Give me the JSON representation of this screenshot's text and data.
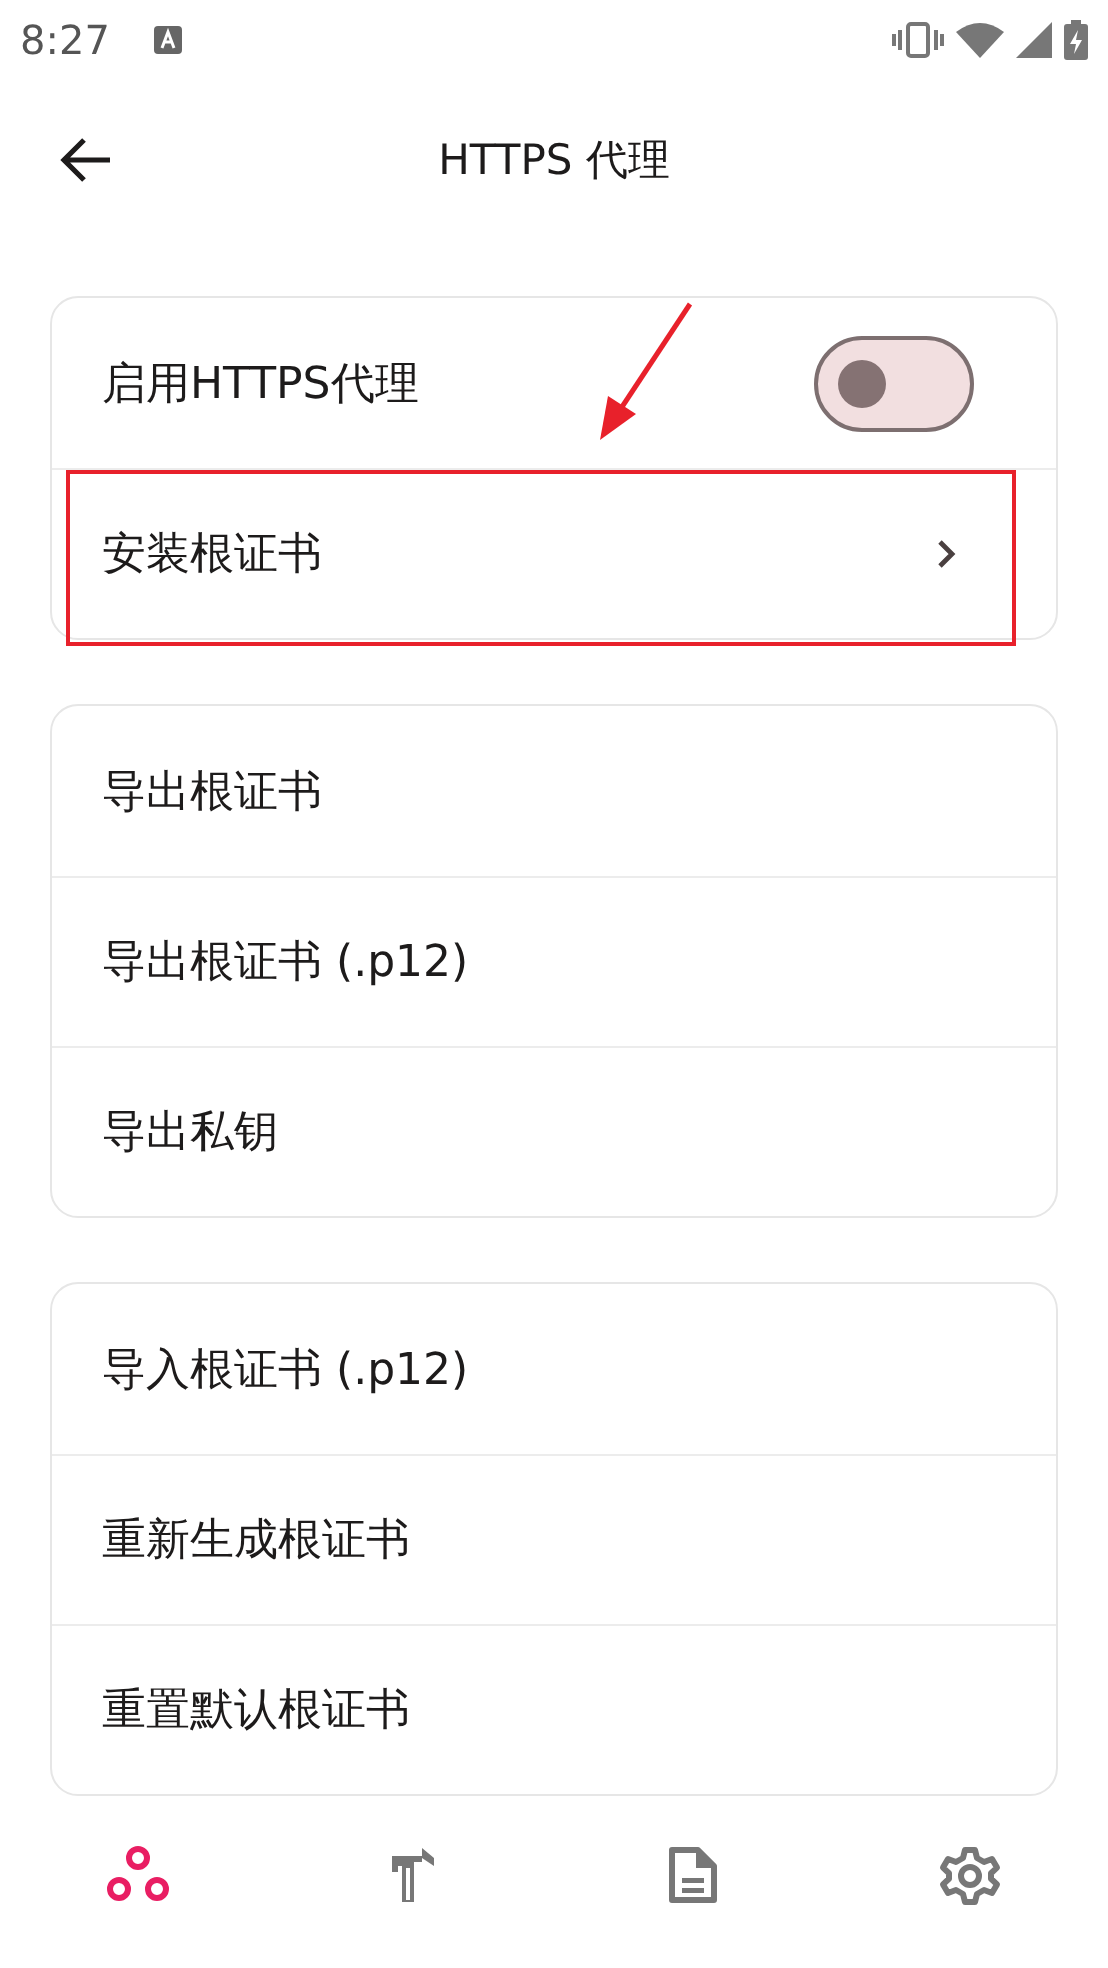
{
  "status_bar": {
    "time": "8:27"
  },
  "app_bar": {
    "title": "HTTPS 代理"
  },
  "groups": [
    {
      "items": [
        {
          "kind": "switch",
          "label": "启用HTTPS代理",
          "on": false,
          "highlighted": false
        },
        {
          "kind": "link",
          "label": "安装根证书",
          "highlighted": true
        }
      ]
    },
    {
      "items": [
        {
          "kind": "plain",
          "label": "导出根证书",
          "highlighted": false
        },
        {
          "kind": "plain",
          "label": "导出根证书 (.p12)",
          "highlighted": false
        },
        {
          "kind": "plain",
          "label": "导出私钥",
          "highlighted": false
        }
      ]
    },
    {
      "items": [
        {
          "kind": "plain",
          "label": "导入根证书 (.p12)",
          "highlighted": false
        },
        {
          "kind": "plain",
          "label": "重新生成根证书",
          "highlighted": false
        },
        {
          "kind": "plain",
          "label": "重置默认根证书",
          "highlighted": false
        }
      ]
    }
  ],
  "bottom_nav": [
    {
      "selected": true
    },
    {
      "selected": false
    },
    {
      "selected": false
    },
    {
      "selected": false
    }
  ]
}
